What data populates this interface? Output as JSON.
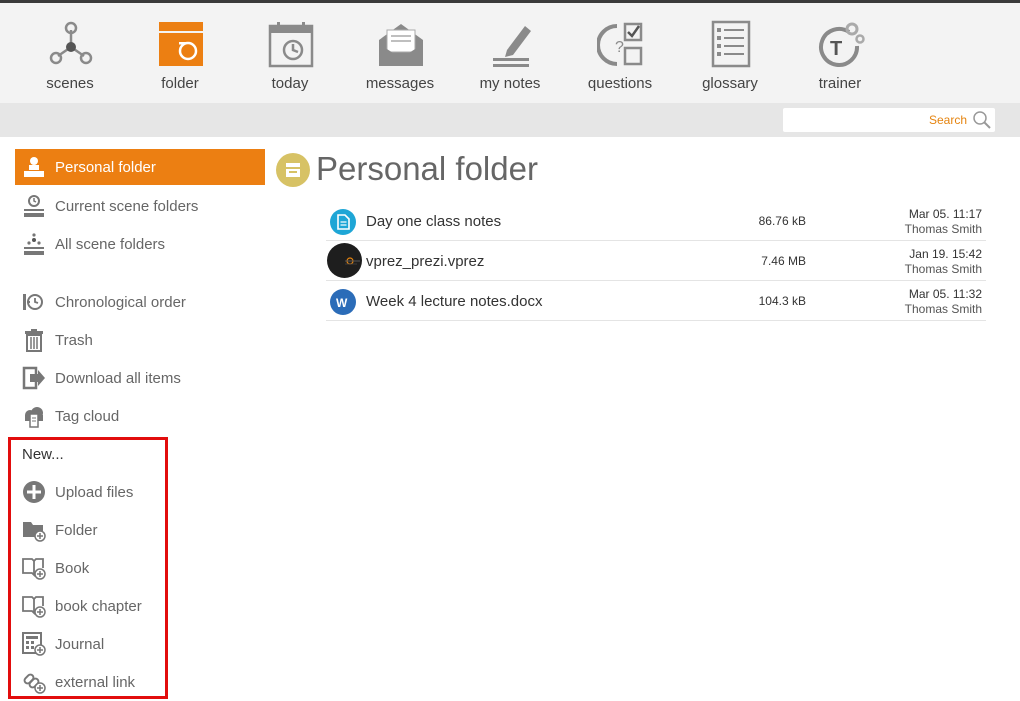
{
  "nav": [
    {
      "label": "scenes",
      "icon": "scenes-icon"
    },
    {
      "label": "folder",
      "icon": "folder-icon"
    },
    {
      "label": "today",
      "icon": "calendar-icon"
    },
    {
      "label": "messages",
      "icon": "envelope-icon"
    },
    {
      "label": "my notes",
      "icon": "pencil-note-icon"
    },
    {
      "label": "questions",
      "icon": "questions-icon"
    },
    {
      "label": "glossary",
      "icon": "glossary-icon"
    },
    {
      "label": "trainer",
      "icon": "trainer-icon"
    }
  ],
  "search": {
    "placeholder": "Search"
  },
  "sidebar": {
    "items": [
      {
        "label": "Personal folder",
        "icon": "personal-folder-icon",
        "active": true
      },
      {
        "label": "Current scene folders",
        "icon": "clock-tray-icon"
      },
      {
        "label": "All scene folders",
        "icon": "scenes-tray-icon"
      },
      {
        "label": "Chronological order",
        "icon": "chronological-icon"
      },
      {
        "label": "Trash",
        "icon": "trash-icon"
      },
      {
        "label": "Download all items",
        "icon": "download-icon"
      },
      {
        "label": "Tag cloud",
        "icon": "tag-cloud-icon"
      }
    ],
    "new_heading": "New...",
    "new_items": [
      {
        "label": "Upload files",
        "icon": "upload-plus-icon"
      },
      {
        "label": "Folder",
        "icon": "folder-plus-icon"
      },
      {
        "label": "Book",
        "icon": "book-plus-icon"
      },
      {
        "label": "book chapter",
        "icon": "book-chapter-plus-icon"
      },
      {
        "label": "Journal",
        "icon": "journal-plus-icon"
      },
      {
        "label": "external link",
        "icon": "link-plus-icon"
      }
    ]
  },
  "main": {
    "title": "Personal folder",
    "files": [
      {
        "name": "Day one class notes",
        "size": "86.76 kB",
        "date": "Mar 05. 11:17",
        "owner": "Thomas Smith",
        "icon": "document-icon",
        "color": "#1ea6d6"
      },
      {
        "name": "vprez_prezi.vprez",
        "size": "7.46 MB",
        "date": "Jan 19. 15:42",
        "owner": "Thomas Smith",
        "icon": "presentation-thumbnail-icon",
        "color": "#1e1e1e"
      },
      {
        "name": "Week 4 lecture notes.docx",
        "size": "104.3 kB",
        "date": "Mar 05. 11:32",
        "owner": "Thomas Smith",
        "icon": "word-doc-icon",
        "color": "#2b6cb8"
      }
    ]
  },
  "colors": {
    "accent": "#ec7f12",
    "highlight": "#e20d0d",
    "icon_gray": "#8a8a8a"
  }
}
